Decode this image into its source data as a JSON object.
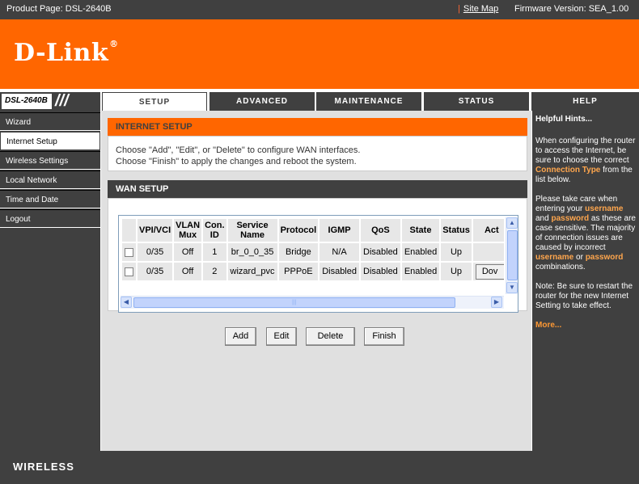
{
  "topbar": {
    "product": "Product Page: DSL-2640B",
    "site_map": "Site Map",
    "firmware": "Firmware Version: SEA_1.00"
  },
  "brand": {
    "logo": "D-Link",
    "reg_mark": "®"
  },
  "model": "DSL-2640B",
  "tabs": [
    {
      "label": "SETUP",
      "active": true
    },
    {
      "label": "ADVANCED",
      "active": false
    },
    {
      "label": "MAINTENANCE",
      "active": false
    },
    {
      "label": "STATUS",
      "active": false
    },
    {
      "label": "HELP",
      "active": false
    }
  ],
  "sidebar": {
    "items": [
      {
        "label": "Wizard"
      },
      {
        "label": "Internet Setup",
        "active": true
      },
      {
        "label": "Wireless Settings"
      },
      {
        "label": "Local Network"
      },
      {
        "label": "Time and Date"
      },
      {
        "label": "Logout"
      }
    ]
  },
  "internet_setup": {
    "title": "INTERNET SETUP",
    "line1": "Choose \"Add\", \"Edit\", or \"Delete\" to configure WAN interfaces.",
    "line2": "Choose \"Finish\" to apply the changes and reboot the system."
  },
  "wan_setup": {
    "title": "WAN SETUP",
    "columns": [
      "",
      "VPI/VCI",
      "VLAN Mux",
      "Con. ID",
      "Service Name",
      "Protocol",
      "IGMP",
      "QoS",
      "State",
      "Status",
      "Act"
    ],
    "rows": [
      {
        "vpi_vci": "0/35",
        "vlan_mux": "Off",
        "con_id": "1",
        "service_name": "br_0_0_35",
        "protocol": "Bridge",
        "igmp": "N/A",
        "qos": "Disabled",
        "state": "Enabled",
        "status": "Up",
        "action": ""
      },
      {
        "vpi_vci": "0/35",
        "vlan_mux": "Off",
        "con_id": "2",
        "service_name": "wizard_pvc",
        "protocol": "PPPoE",
        "igmp": "Disabled",
        "qos": "Disabled",
        "state": "Enabled",
        "status": "Up",
        "action": "Dov"
      }
    ]
  },
  "buttons": {
    "add": "Add",
    "edit": "Edit",
    "delete": "Delete",
    "finish": "Finish"
  },
  "hints": {
    "title": "Helpful Hints...",
    "p1_a": "When configuring the router to access the Internet, be sure to choose the correct ",
    "p1_kw": "Connection Type",
    "p1_b": " from the list below.",
    "p2_a": "Please take care when entering your ",
    "p2_kw1": "username",
    "p2_b": " and ",
    "p2_kw2": "password",
    "p2_c": " as these are case sensitive. The majority of connection issues are caused by incorrect ",
    "p2_kw3": "username",
    "p2_d": " or ",
    "p2_kw4": "password",
    "p2_e": " combinations.",
    "p3": "Note: Be sure to restart the router for the new Internet Setting to take effect.",
    "more": "More..."
  },
  "footer": {
    "label": "WIRELESS"
  },
  "colors": {
    "orange": "#ff6600",
    "dark": "#404040",
    "panel": "#e0e0e0"
  }
}
